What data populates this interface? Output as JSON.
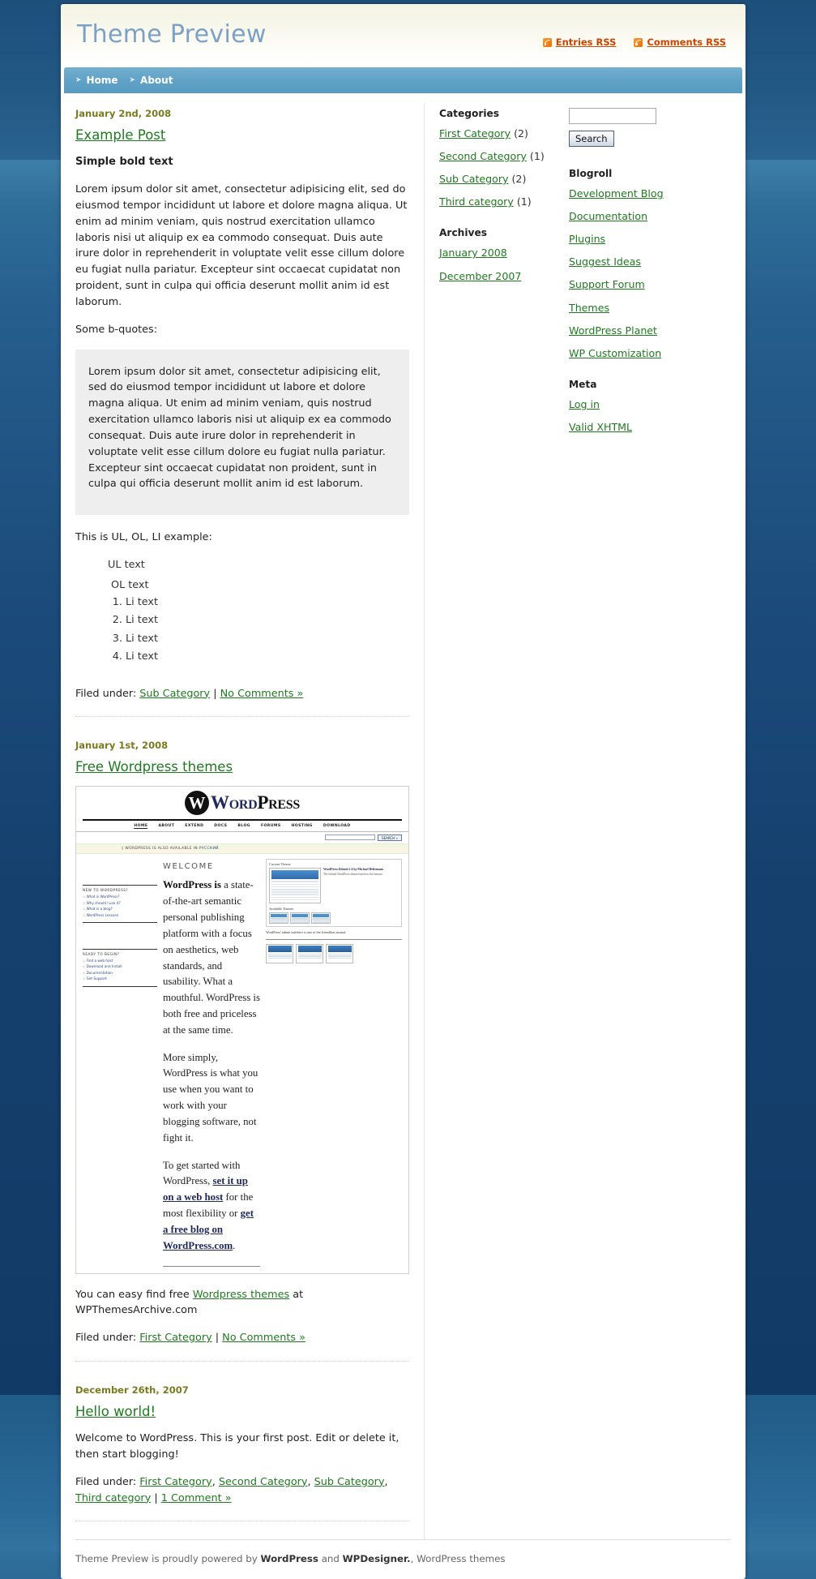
{
  "header": {
    "blog_title": "Theme Preview",
    "feeds": [
      {
        "label": "Entries RSS",
        "icon": "rss-icon"
      },
      {
        "label": "Comments RSS",
        "icon": "rss-icon"
      }
    ]
  },
  "nav": {
    "items": [
      {
        "label": "Home"
      },
      {
        "label": "About"
      }
    ]
  },
  "posts": [
    {
      "date": "January 2nd, 2008",
      "title": "Example Post",
      "bold_lead": "Simple bold text",
      "paragraph1": "Lorem ipsum dolor sit amet, consectetur adipisicing elit, sed do eiusmod tempor incididunt ut labore et dolore magna aliqua. Ut enim ad minim veniam, quis nostrud exercitation ullamco laboris nisi ut aliquip ex ea commodo consequat. Duis aute irure dolor in reprehenderit in voluptate velit esse cillum dolore eu fugiat nulla pariatur. Excepteur sint occaecat cupidatat non proident, sunt in culpa qui officia deserunt mollit anim id est laborum.",
      "quote_intro": "Some b-quotes:",
      "blockquote": "Lorem ipsum dolor sit amet, consectetur adipisicing elit, sed do eiusmod tempor incididunt ut labore et dolore magna aliqua. Ut enim ad minim veniam, quis nostrud exercitation ullamco laboris nisi ut aliquip ex ea commodo consequat. Duis aute irure dolor in reprehenderit in voluptate velit esse cillum dolore eu fugiat nulla pariatur. Excepteur sint occaecat cupidatat non proident, sunt in culpa qui officia deserunt mollit anim id est laborum.",
      "list_intro": "This is UL, OL, LI example:",
      "ul_item": "UL text",
      "ol_item": "OL text",
      "li_items": [
        "Li text",
        "Li text",
        "Li text",
        "Li text"
      ],
      "filed_label": "Filed under:",
      "categories": [
        "Sub Category"
      ],
      "separator": "|",
      "comments_link": "No Comments »"
    },
    {
      "date": "January 1st, 2008",
      "title": "Free Wordpress themes",
      "caption_before": "You can easy find free ",
      "caption_link": "Wordpress themes",
      "caption_after": " at WPThemesArchive.com",
      "filed_label": "Filed under:",
      "categories": [
        "First Category"
      ],
      "separator": "|",
      "comments_link": "No Comments »"
    },
    {
      "date": "December 26th, 2007",
      "title": "Hello world!",
      "paragraph1": "Welcome to WordPress. This is your first post. Edit or delete it, then start blogging!",
      "filed_label": "Filed under:",
      "categories": [
        "First Category",
        "Second Category",
        "Sub Category",
        "Third category"
      ],
      "separator": "|",
      "comments_link": "1 Comment »"
    }
  ],
  "wp_screenshot": {
    "logo_w": "W",
    "logo_word_a": "Word",
    "logo_word_b": "Press",
    "nav": [
      "HOME",
      "ABOUT",
      "EXTEND",
      "DOCS",
      "BLOG",
      "FORUMS",
      "HOSTING",
      "DOWNLOAD"
    ],
    "search_button": "SEARCH »",
    "banner": "◊ WORDPRESS IS ALSO AVAILABLE IN ",
    "banner_lang": "РУССКИЙ.",
    "welcome": "WELCOME",
    "box1_title": "NEW TO WORDPRESS?",
    "box1_items": [
      "What is WordPress?",
      "Why should I use it?",
      "What is a blog?",
      "WordPress Lessons"
    ],
    "box2_title": "READY TO BEGIN?",
    "box2_items": [
      "Find a web host",
      "Download and Install",
      "Documentation",
      "Get Support"
    ],
    "para1_bold": "WordPress is",
    "para1": " a state-of-the-art semantic personal publishing platform with a focus on aesthetics, web standards, and usability. What a mouthful. WordPress is both free and priceless at the same time.",
    "para2": "More simply, WordPress is what you use when you want to work with your blogging software, not fight it.",
    "para3_a": "To get started with WordPress, ",
    "para3_b": "set it up on a web host",
    "para3_c": " for the most flexibility or ",
    "para3_d": "get a free blog on WordPress.com",
    "para3_e": ".",
    "panel_title": "Current Theme",
    "panel_meta_title": "WordPress Default 1.6 by Michael Heilemann",
    "panel_meta_body": "The default WordPress theme based on the famous.",
    "available_themes": "Available Themes",
    "caption": "WordPress' admin interface is one of the friendliest around."
  },
  "sidebar": {
    "categories_title": "Categories",
    "categories": [
      {
        "label": "First Category",
        "count": "(2)"
      },
      {
        "label": "Second Category",
        "count": "(1)"
      },
      {
        "label": "Sub Category",
        "count": "(2)"
      },
      {
        "label": "Third category",
        "count": "(1)"
      }
    ],
    "archives_title": "Archives",
    "archives": [
      {
        "label": "January 2008"
      },
      {
        "label": "December 2007"
      }
    ],
    "search": {
      "value": "",
      "placeholder": "",
      "button": "Search"
    },
    "blogroll_title": "Blogroll",
    "blogroll": [
      {
        "label": "Development Blog"
      },
      {
        "label": "Documentation"
      },
      {
        "label": "Plugins"
      },
      {
        "label": "Suggest Ideas"
      },
      {
        "label": "Support Forum"
      },
      {
        "label": "Themes"
      },
      {
        "label": "WordPress Planet"
      },
      {
        "label": "WP Customization"
      }
    ],
    "meta_title": "Meta",
    "meta": [
      {
        "label": "Log in"
      },
      {
        "label": "Valid XHTML"
      }
    ]
  },
  "footer": {
    "text_a": "Theme Preview is proudly powered by ",
    "link_a": "WordPress",
    "text_b": " and ",
    "link_b": "WPDesigner.",
    "text_c": ", ",
    "link_c": "WordPress themes"
  },
  "colors": {
    "link_green": "#1f7a1f",
    "date_olive": "#7a7a1f",
    "rss_orange": "#cc4400",
    "nav_blue": "#62a3c7",
    "title_blue": "#7da1c4",
    "page_bg": "#1b4f7a"
  }
}
